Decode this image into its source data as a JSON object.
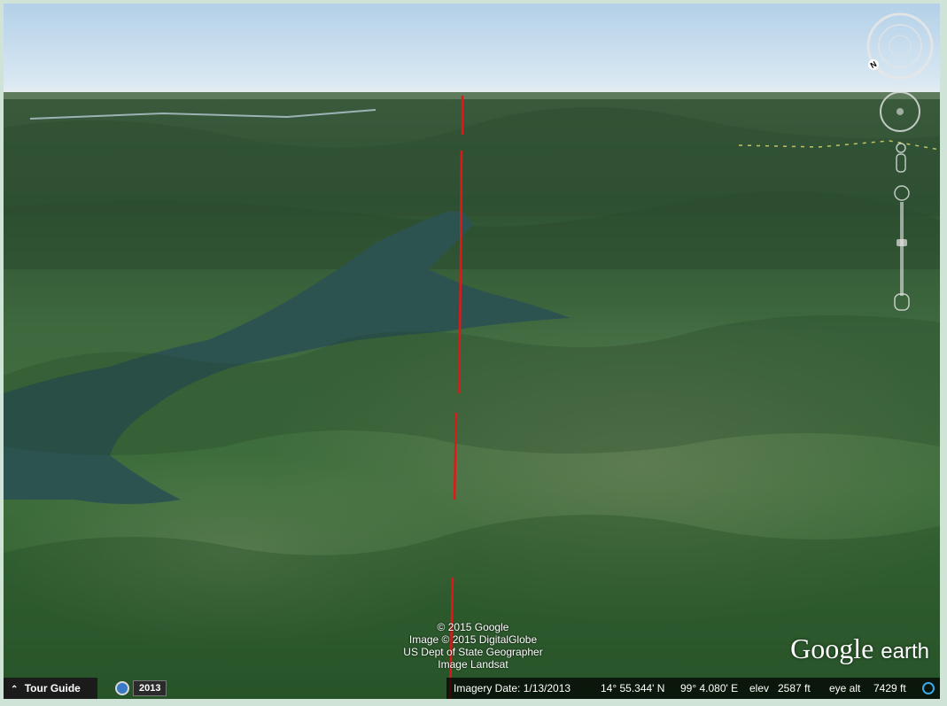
{
  "map": {
    "credits": [
      "© 2015 Google",
      "Image © 2015 DigitalGlobe",
      "US Dept of State Geographer",
      "Image Landsat"
    ],
    "logo": {
      "google": "Google",
      "earth": "earth"
    }
  },
  "controls": {
    "compass_label": "N",
    "tour_guide": "Tour Guide",
    "historical_year": "2013"
  },
  "status": {
    "imagery_date": "Imagery Date: 1/13/2013",
    "latitude": "14° 55.344' N",
    "longitude": "99° 4.080' E",
    "elev_label": "elev",
    "elev_value": "2587 ft",
    "eye_alt_label": "eye alt",
    "eye_alt_value": "7429 ft"
  },
  "colors": {
    "path_line": "#e01818",
    "sky_top": "#b3d0e8",
    "water": "#2d5350",
    "forest": "#3e6e3c",
    "frame": "#cfe3d6"
  }
}
